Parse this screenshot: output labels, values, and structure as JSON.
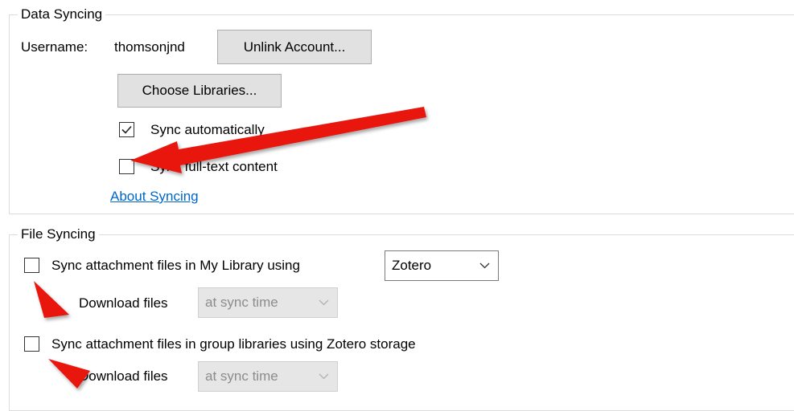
{
  "data_syncing": {
    "group_title": "Data Syncing",
    "username_label": "Username:",
    "username_value": "thomsonjnd",
    "unlink_button": "Unlink Account...",
    "choose_libraries_button": "Choose Libraries...",
    "sync_automatically": {
      "label": "Sync automatically",
      "checked": true
    },
    "sync_fulltext": {
      "label": "Sync full-text content",
      "checked": false
    },
    "about_link": "About Syncing"
  },
  "file_syncing": {
    "group_title": "File Syncing",
    "my_library": {
      "label": "Sync attachment files in My Library using",
      "checked": false,
      "method_select": "Zotero",
      "download_label": "Download files",
      "download_select": "at sync time"
    },
    "group_libraries": {
      "label": "Sync attachment files in group libraries using Zotero storage",
      "checked": false,
      "download_label": "Download files",
      "download_select": "at sync time"
    }
  },
  "annotations": {
    "arrow_color": "#e8120c",
    "arrows": [
      "arrow-to-fulltext",
      "arrow-to-mylibrary-checkbox",
      "arrow-to-group-checkbox"
    ]
  },
  "icons": {
    "checkmark": "checkmark-icon",
    "dropdown": "chevron-down-icon"
  }
}
